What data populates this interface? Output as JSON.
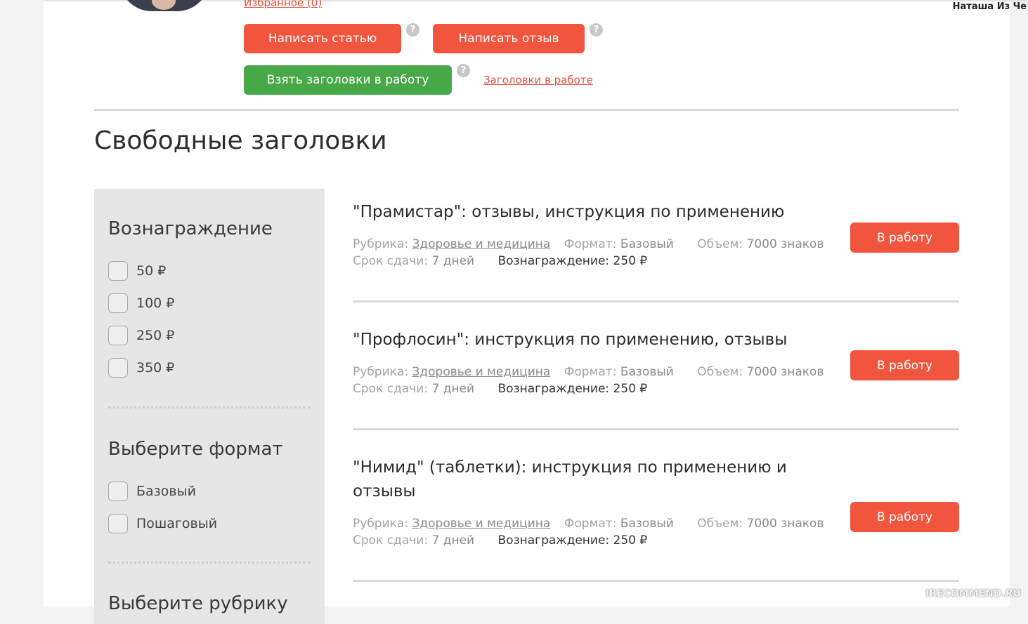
{
  "header": {
    "user_name": "Наташа Из Че",
    "favorites_link": "Избранное (0)",
    "write_article_label": "Написать статью",
    "write_review_label": "Написать отзыв",
    "take_titles_label": "Взять заголовки в работу",
    "titles_in_work_link": "Заголовки в работе",
    "help_glyph": "?"
  },
  "section_title": "Свободные заголовки",
  "filters": {
    "reward": {
      "title": "Вознаграждение",
      "options": [
        "50 ₽",
        "100 ₽",
        "250 ₽",
        "350 ₽"
      ]
    },
    "format": {
      "title": "Выберите формат",
      "options": [
        "Базовый",
        "Пошаговый"
      ]
    },
    "rubric": {
      "title": "Выберите рубрику"
    }
  },
  "items": [
    {
      "title": "\"Прамистар\": отзывы, инструкция по применению",
      "rubric_label": "Рубрика:",
      "rubric": "Здоровье и медицина",
      "format_label": "Формат:",
      "format": "Базовый",
      "volume_label": "Объем:",
      "volume": "7000 знаков",
      "deadline_label": "Срок сдачи:",
      "deadline": "7 дней",
      "reward": "Вознаграждение: 250 ₽",
      "button": "В работу"
    },
    {
      "title": "\"Профлосин\": инструкция по применению, отзывы",
      "rubric_label": "Рубрика:",
      "rubric": "Здоровье и медицина",
      "format_label": "Формат:",
      "format": "Базовый",
      "volume_label": "Объем:",
      "volume": "7000 знаков",
      "deadline_label": "Срок сдачи:",
      "deadline": "7 дней",
      "reward": "Вознаграждение: 250 ₽",
      "button": "В работу"
    },
    {
      "title": "\"Нимид\" (таблетки): инструкция по применению и отзывы",
      "rubric_label": "Рубрика:",
      "rubric": "Здоровье и медицина",
      "format_label": "Формат:",
      "format": "Базовый",
      "volume_label": "Объем:",
      "volume": "7000 знаков",
      "deadline_label": "Срок сдачи:",
      "deadline": "7 дней",
      "reward": "Вознаграждение: 250 ₽",
      "button": "В работу"
    }
  ],
  "watermark": "IRECOMMEND.RU",
  "colors": {
    "accent_red": "#f2553d",
    "accent_green": "#47a847",
    "link_red": "#e2533f",
    "sidebar_bg": "#e6e6e6"
  }
}
